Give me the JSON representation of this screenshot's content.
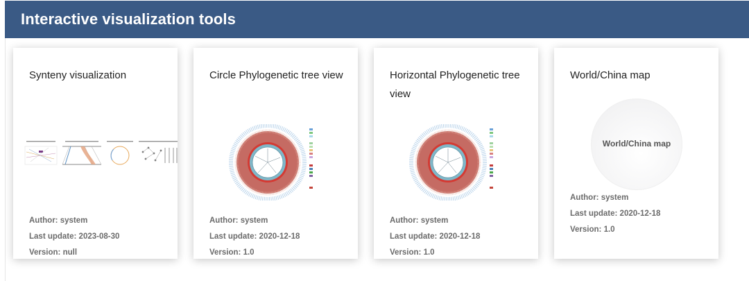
{
  "header": {
    "title": "Interactive visualization tools"
  },
  "cards": [
    {
      "title": "Synteny visualization",
      "author": "Author: system",
      "last_update": "Last update: 2023-08-30",
      "version": "Version: null"
    },
    {
      "title": "Circle Phylogenetic tree view",
      "author": "Author: system",
      "last_update": "Last update: 2020-12-18",
      "version": "Version: 1.0"
    },
    {
      "title": "Horizontal Phylogenetic tree view",
      "author": "Author: system",
      "last_update": "Last update: 2020-12-18",
      "version": "Version: 1.0"
    },
    {
      "title": "World/China map",
      "thumb_label": "World/China map",
      "author": "Author: system",
      "last_update": "Last update: 2020-12-18",
      "version": "Version: 1.0"
    }
  ],
  "colors": {
    "header_bg": "#3a5a85",
    "tree_ring": "#c0504d",
    "tree_inner": "#7fb8c9"
  }
}
